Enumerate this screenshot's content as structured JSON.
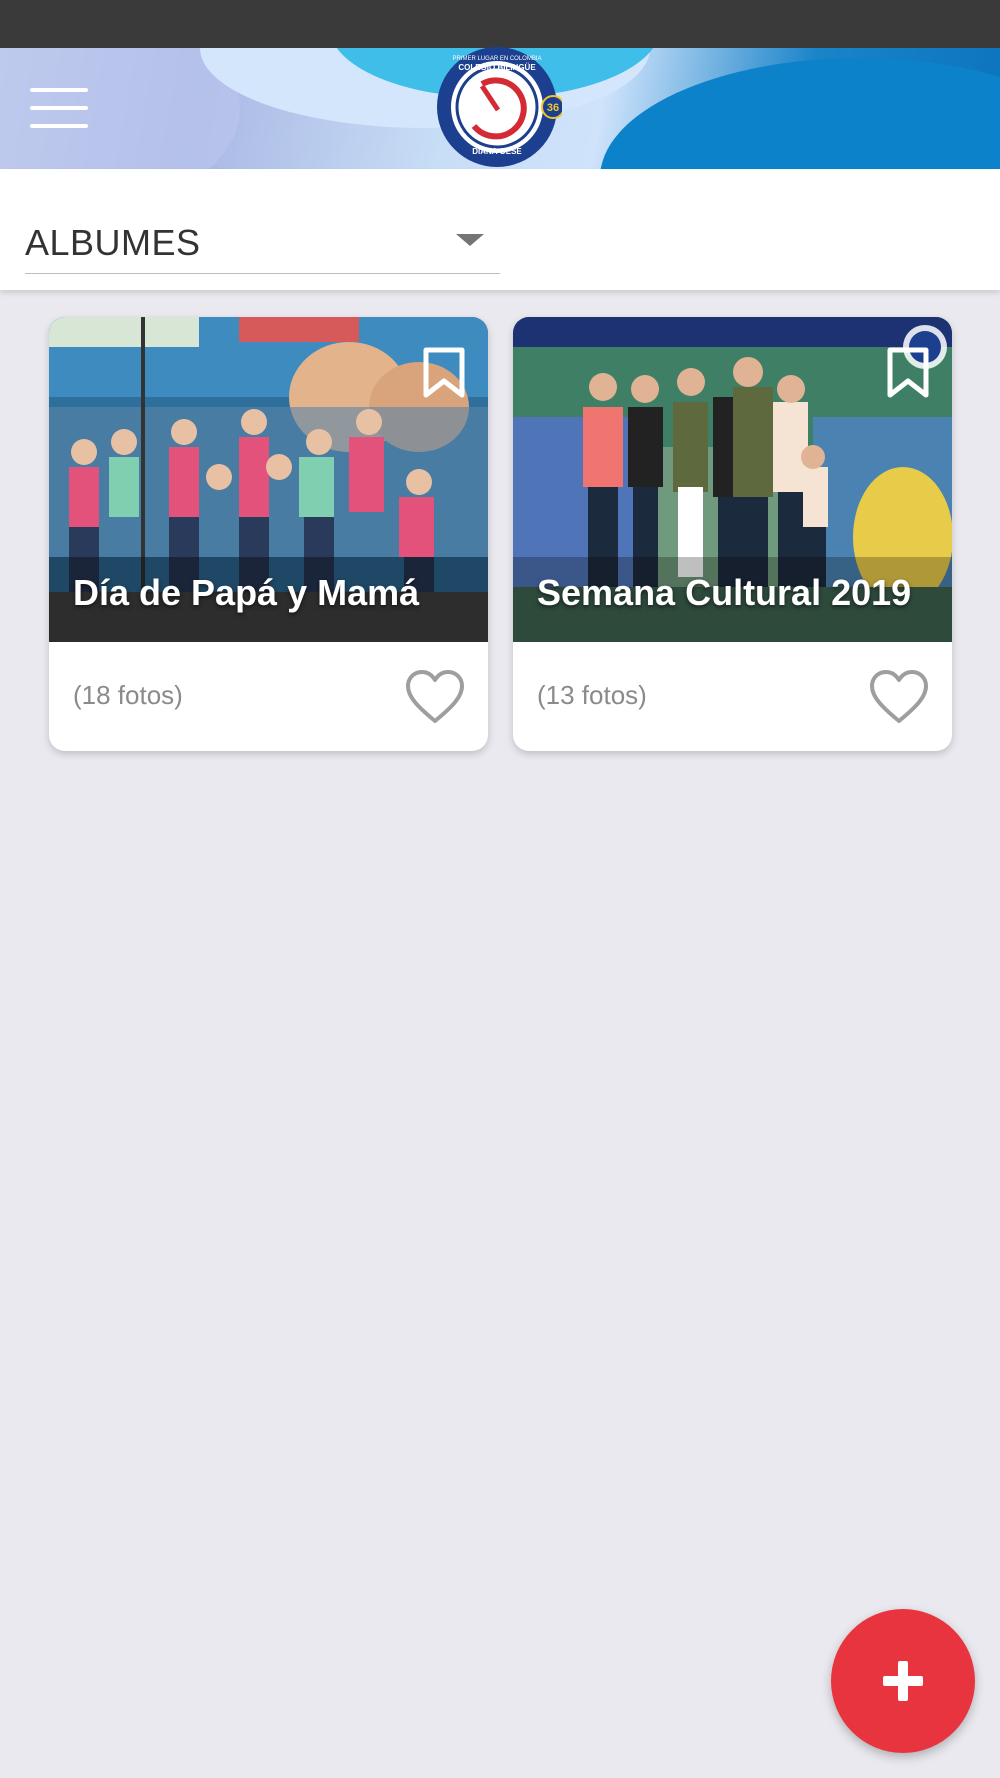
{
  "header": {
    "menu_icon": "hamburger-menu-icon",
    "logo": {
      "name": "colegio-bilingue-diana-oese-logo",
      "top_text": "PRIMER LUGAR EN COLOMBIA",
      "school": "COLEGIO BILINGÜE",
      "name_text": "DIANA OESE",
      "years": "36",
      "bottom_text": "PRUEBAS SABER 11, 2013, 2014, 2019 Cal. B"
    },
    "colors": {
      "accent": "#0b82ca",
      "light": "#cfe3fb"
    }
  },
  "filter": {
    "selected": "ALBUMES",
    "dropdown_icon": "caret-down-icon"
  },
  "albums": [
    {
      "title": "Día de Papá y Mamá",
      "count": "(18 fotos)",
      "bookmark_icon": "bookmark-outline-icon",
      "favorite_icon": "heart-outline-icon"
    },
    {
      "title": "Semana Cultural 2019",
      "count": "(13 fotos)",
      "bookmark_icon": "bookmark-outline-icon",
      "favorite_icon": "heart-outline-icon"
    }
  ],
  "fab": {
    "icon": "plus-icon",
    "color": "#e8343f"
  }
}
